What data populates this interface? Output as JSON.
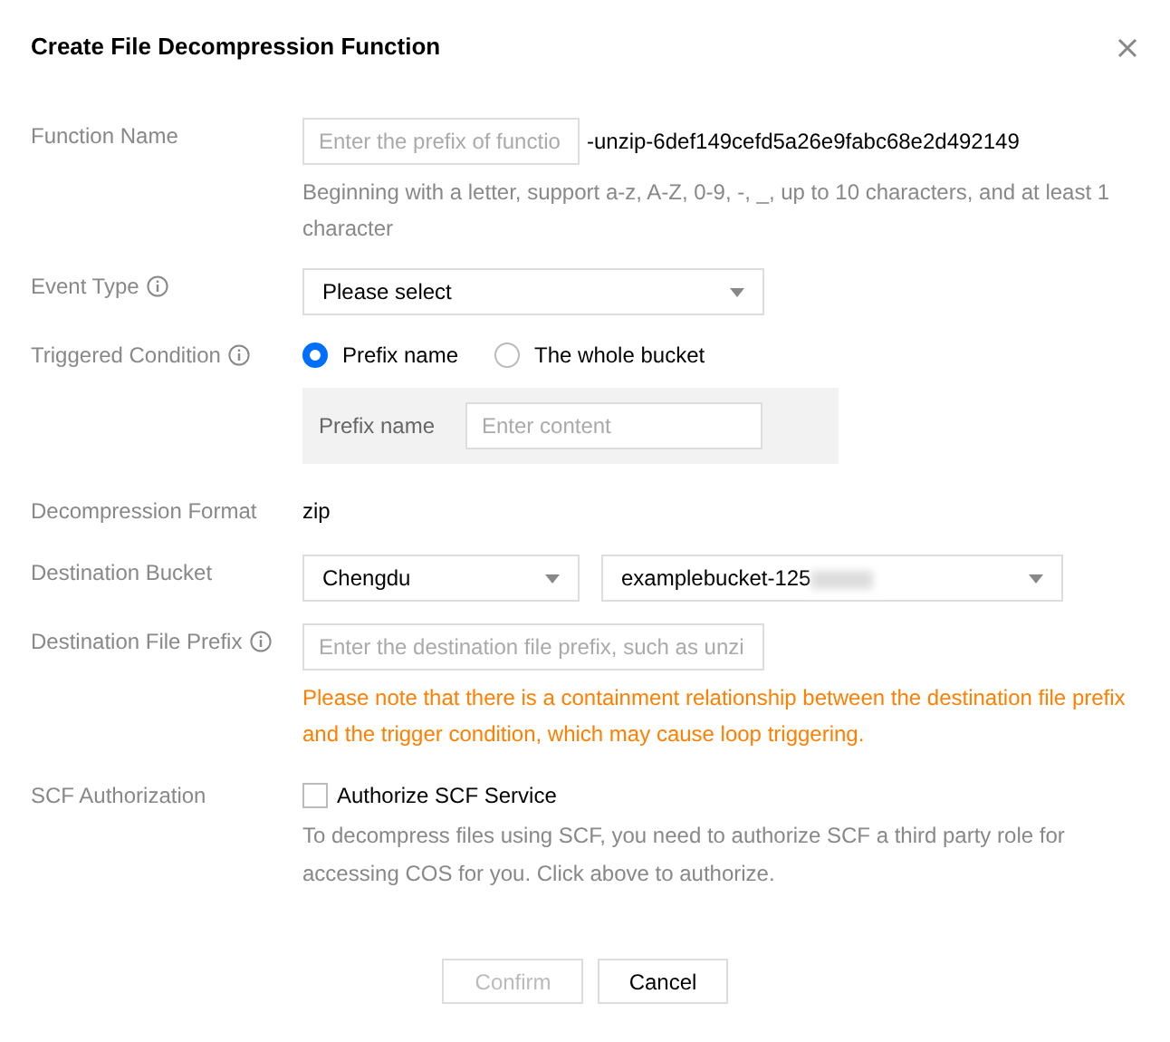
{
  "dialog": {
    "title": "Create File Decompression Function"
  },
  "function_name": {
    "label": "Function Name",
    "placeholder": "Enter the prefix of functio",
    "suffix": "-unzip-6def149cefd5a26e9fabc68e2d492149",
    "hint": "Beginning with a letter, support a-z, A-Z, 0-9, -, _, up to 10 characters, and at least 1 character"
  },
  "event_type": {
    "label": "Event Type",
    "info": true,
    "value": "Please select"
  },
  "triggered_condition": {
    "label": "Triggered Condition",
    "info": true,
    "options": [
      {
        "label": "Prefix name",
        "selected": true
      },
      {
        "label": "The whole bucket",
        "selected": false
      }
    ],
    "prefix": {
      "label": "Prefix name",
      "placeholder": "Enter content"
    }
  },
  "decompression_format": {
    "label": "Decompression Format",
    "value": "zip"
  },
  "destination_bucket": {
    "label": "Destination Bucket",
    "region": "Chengdu",
    "bucket": "examplebucket-125",
    "redacted": true
  },
  "destination_prefix": {
    "label": "Destination File Prefix",
    "info": true,
    "placeholder": "Enter the destination file prefix, such as unzi",
    "warning": "Please note that there is a containment relationship between the destination file prefix and the trigger condition, which may cause loop triggering."
  },
  "scf_authorization": {
    "label": "SCF Authorization",
    "checkbox": "Authorize SCF Service",
    "checked": false,
    "description": "To decompress files using SCF, you need to authorize SCF a third party role for accessing COS for you. Click above to authorize."
  },
  "buttons": [
    {
      "label": "Confirm",
      "disabled": true
    },
    {
      "label": "Cancel",
      "disabled": false
    }
  ]
}
